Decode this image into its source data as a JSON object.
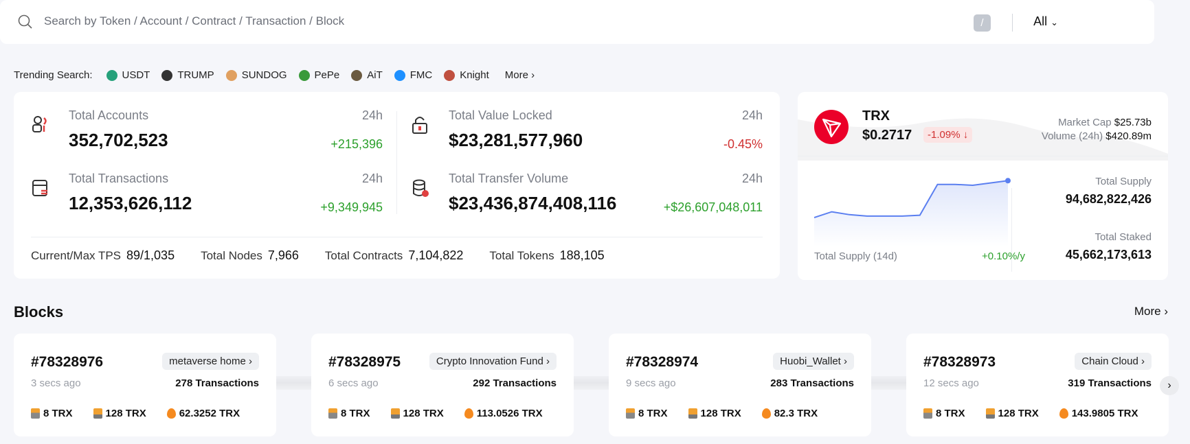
{
  "search": {
    "placeholder": "Search by Token / Account / Contract / Transaction / Block",
    "shortcut": "/",
    "filter": "All"
  },
  "trending": {
    "label": "Trending Search:",
    "items": [
      {
        "name": "USDT",
        "color": "#26a17b"
      },
      {
        "name": "TRUMP",
        "color": "#333333"
      },
      {
        "name": "SUNDOG",
        "color": "#e0a060"
      },
      {
        "name": "PePe",
        "color": "#3a9a3a"
      },
      {
        "name": "AiT",
        "color": "#6b5a40"
      },
      {
        "name": "FMC",
        "color": "#1e90ff"
      },
      {
        "name": "Knight",
        "color": "#c05040"
      }
    ],
    "more": "More"
  },
  "stats": [
    {
      "title": "Total Accounts",
      "value": "352,702,523",
      "period": "24h",
      "delta": "+215,396",
      "trend": "up",
      "icon": "accounts-icon"
    },
    {
      "title": "Total Value Locked",
      "value": "$23,281,577,960",
      "period": "24h",
      "delta": "-0.45%",
      "trend": "down",
      "icon": "lock-icon"
    },
    {
      "title": "Total Transactions",
      "value": "12,353,626,112",
      "period": "24h",
      "delta": "+9,349,945",
      "trend": "up",
      "icon": "transactions-icon"
    },
    {
      "title": "Total Transfer Volume",
      "value": "$23,436,874,408,116",
      "period": "24h",
      "delta": "+$26,607,048,011",
      "trend": "up",
      "icon": "database-icon"
    }
  ],
  "footer": [
    {
      "label": "Current/Max TPS",
      "value": "89/1,035"
    },
    {
      "label": "Total Nodes",
      "value": "7,966"
    },
    {
      "label": "Total Contracts",
      "value": "7,104,822"
    },
    {
      "label": "Total Tokens",
      "value": "188,105"
    }
  ],
  "trx": {
    "symbol": "TRX",
    "price": "$0.2717",
    "change": "-1.09%",
    "market_cap_label": "Market Cap",
    "market_cap": "$25.73b",
    "volume_label": "Volume (24h)",
    "volume": "$420.89m",
    "supply_chart_label": "Total Supply (14d)",
    "supply_rate": "+0.10%/y",
    "total_supply_label": "Total Supply",
    "total_supply": "94,682,822,426",
    "total_staked_label": "Total Staked",
    "total_staked": "45,662,173,613",
    "brand_color": "#eb0029",
    "line_color": "#5b7ff0"
  },
  "chart_data": {
    "type": "area",
    "title": "Total Supply (14d)",
    "values": [
      94.67,
      94.672,
      94.671,
      94.6705,
      94.6705,
      94.6705,
      94.6708,
      94.6815,
      94.6815,
      94.6812,
      94.682,
      94.6828
    ],
    "ylim": [
      94.66,
      94.685
    ]
  },
  "blocks": {
    "title": "Blocks",
    "more": "More",
    "items": [
      {
        "number": "#78328976",
        "producer": "metaverse home",
        "ago": "3 secs ago",
        "transactions": "278 Transactions",
        "reward1": "8 TRX",
        "reward2": "128 TRX",
        "burn": "62.3252 TRX"
      },
      {
        "number": "#78328975",
        "producer": "Crypto Innovation Fund",
        "ago": "6 secs ago",
        "transactions": "292 Transactions",
        "reward1": "8 TRX",
        "reward2": "128 TRX",
        "burn": "113.0526 TRX"
      },
      {
        "number": "#78328974",
        "producer": "Huobi_Wallet",
        "ago": "9 secs ago",
        "transactions": "283 Transactions",
        "reward1": "8 TRX",
        "reward2": "128 TRX",
        "burn": "82.3 TRX"
      },
      {
        "number": "#78328973",
        "producer": "Chain Cloud",
        "ago": "12 secs ago",
        "transactions": "319 Transactions",
        "reward1": "8 TRX",
        "reward2": "128 TRX",
        "burn": "143.9805 TRX"
      }
    ]
  }
}
